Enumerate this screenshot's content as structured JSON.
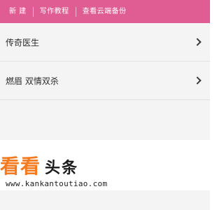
{
  "toolbar": {
    "new_label": "新 建",
    "tutorial_label": "写作教程",
    "cloud_backup_label": "查看云端备份"
  },
  "list": {
    "items": [
      {
        "title": "传奇医生"
      },
      {
        "title": "燃眉 双情双杀"
      }
    ]
  },
  "watermark": {
    "brand_part1": "看看",
    "brand_part2": "头条",
    "url": "www.kankantoutiao.com"
  },
  "colors": {
    "toolbar_bg": "#e05d93",
    "brand_orange": "#f47a1f"
  },
  "icons": [
    "chevron-right-icon"
  ]
}
